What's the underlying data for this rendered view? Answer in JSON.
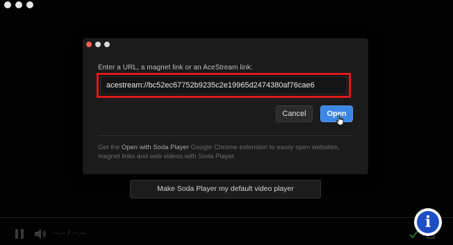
{
  "dialog": {
    "prompt": "Enter a URL, a magnet link or an AceStream link:",
    "url_value": "acestream://bc52ec67752b9235c2e19965d2474380af76cae6",
    "cancel_label": "Cancel",
    "open_label": "Open",
    "extension_text_before": "Get the ",
    "extension_link": "Open with Soda Player",
    "extension_text_after": " Google Chrome extension to easily open websites, magnet links and web videos with Soda Player."
  },
  "default_player_button": "Make Soda Player my default video player",
  "controls": {
    "time": "--:-- / --:--",
    "icons": [
      "pause-icon",
      "volume-icon",
      "check-icon",
      "fullscreen-icon"
    ]
  },
  "info_badge": {
    "glyph": "i"
  },
  "colors": {
    "highlight_border": "#e01a1a",
    "open_button": "#3a87e6",
    "info_badge": "#1e4ec4",
    "close_dot": "#ff5f57"
  }
}
